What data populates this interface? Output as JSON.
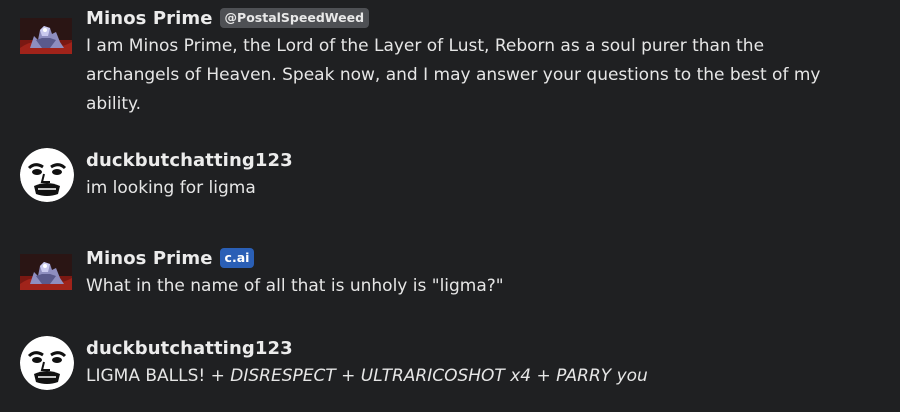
{
  "messages": [
    {
      "author": "Minos Prime",
      "badge": "@PostalSpeedWeed",
      "text": "I am Minos Prime, the Lord of the Layer of Lust, Reborn as a soul purer than the archangels of Heaven. Speak now, and I may answer your questions to the best of my ability."
    },
    {
      "author": "duckbutchatting123",
      "text": "im looking for ligma"
    },
    {
      "author": "Minos Prime",
      "badge": "c.ai",
      "text": "What in the name of all that is unholy is \"ligma?\""
    },
    {
      "author": "duckbutchatting123",
      "text_plain": "LIGMA BALLS! + ",
      "text_italic": "DISRESPECT + ULTRARICOSHOT x4 + PARRY you"
    }
  ],
  "colors": {
    "background": "#1f2022",
    "handle_badge": "#4e5054",
    "cai_badge": "#2a5fb6",
    "bot_avatar_red": "#8a1a14"
  },
  "icons": {
    "bot_avatar": "minos-prime-avatar-icon",
    "user_avatar": "meme-face-avatar-icon"
  }
}
